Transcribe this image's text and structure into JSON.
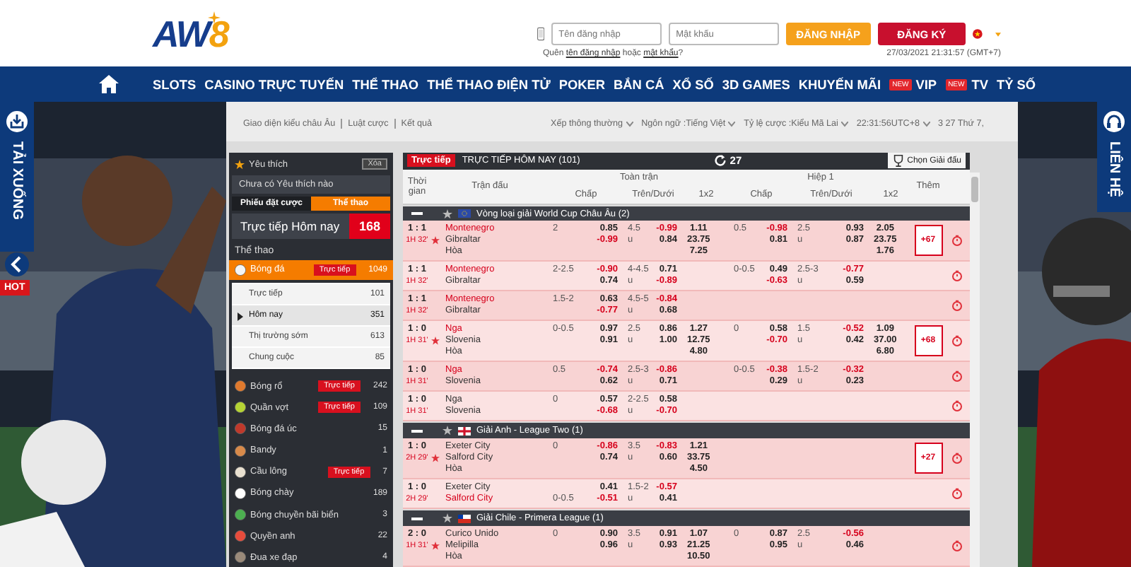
{
  "header": {
    "logo": {
      "main": "AW",
      "accent": "8"
    },
    "username": {
      "placeholder": "Tên đăng nhập"
    },
    "password": {
      "placeholder": "Mật khẩu"
    },
    "login": "ĐĂNG NHẬP",
    "register": "ĐĂNG KÝ",
    "forgot": {
      "before": "Quên",
      "link1": "tên đăng nhập",
      "middle": "hoặc",
      "link2": "mật khẩu",
      "after": "?"
    },
    "clock": "27/03/2021 21:31:57 (GMT+7)"
  },
  "nav": [
    {
      "label": "SLOTS"
    },
    {
      "label": "CASINO TRỰC TUYẾN"
    },
    {
      "label": "THỂ THAO"
    },
    {
      "label": "THỂ THAO ĐIỆN TỬ"
    },
    {
      "label": "POKER"
    },
    {
      "label": "BẮN CÁ"
    },
    {
      "label": "XỔ SỐ"
    },
    {
      "label": "3D GAMES"
    },
    {
      "label": "KHUYẾN MÃI"
    },
    {
      "label": "VIP",
      "badge": "NEW"
    },
    {
      "label": "TV",
      "badge": "NEW"
    },
    {
      "label": "TỶ SỐ"
    }
  ],
  "side_tabs": {
    "left": "TẢI XUỐNG",
    "hot": "HOT",
    "right": "LIÊN HỆ"
  },
  "top_links": [
    "Giao diện kiểu châu Âu",
    "Luật cược",
    "Kết quả"
  ],
  "settings": [
    {
      "label": "Xếp thông thường",
      "kind": "dropdown"
    },
    {
      "label": "Ngôn ngữ :Tiếng Việt",
      "kind": "dropdown"
    },
    {
      "label": "Tỷ lệ cược :Kiểu Mã Lai",
      "kind": "dropdown"
    },
    {
      "label": "22:31:56UTC+8",
      "kind": "dropdown"
    },
    {
      "label": "3 27 Thứ 7,",
      "kind": "text"
    }
  ],
  "sidebar": {
    "favorites": {
      "title": "Yêu thích",
      "clear": "Xóa",
      "empty": "Chưa có Yêu thích nào"
    },
    "tabs": [
      {
        "label": "Phiếu đặt cược",
        "selected": false
      },
      {
        "label": "Thể thao",
        "selected": true
      }
    ],
    "live_today": {
      "label": "Trực tiếp Hôm nay",
      "count": "168"
    },
    "section": "Thể thao",
    "sports": [
      {
        "name": "Bóng đá",
        "live": "Trực tiếp",
        "count": "1049",
        "selected": true,
        "children": [
          {
            "name": "Trực tiếp",
            "count": "101",
            "selected": false
          },
          {
            "name": "Hôm nay",
            "count": "351",
            "selected": true
          },
          {
            "name": "Thị trường sớm",
            "count": "613",
            "selected": false
          },
          {
            "name": "Chung cuộc",
            "count": "85",
            "selected": false
          }
        ]
      },
      {
        "name": "Bóng rổ",
        "live": "Trực tiếp",
        "count": "242",
        "selected": false
      },
      {
        "name": "Quần vợt",
        "live": "Trực tiếp",
        "count": "109",
        "selected": false
      },
      {
        "name": "Bóng đá úc",
        "count": "15",
        "selected": false
      },
      {
        "name": "Bandy",
        "count": "1",
        "selected": false
      },
      {
        "name": "Cầu lông",
        "live": "Trực tiếp",
        "count": "7",
        "selected": false
      },
      {
        "name": "Bóng chày",
        "count": "189",
        "selected": false
      },
      {
        "name": "Bóng chuyền bãi biển",
        "count": "3",
        "selected": false
      },
      {
        "name": "Quyền anh",
        "count": "22",
        "selected": false
      },
      {
        "name": "Đua xe đạp",
        "count": "4",
        "selected": false
      }
    ]
  },
  "table": {
    "badge": "Trực tiếp",
    "title": "TRỰC TIẾP HÔM NAY (101)",
    "refresh": "27",
    "choose": "Chọn Giải đấu",
    "columns": {
      "time": "Thời gian",
      "match": "Trận đấu",
      "full": "Toàn trận",
      "full_sub": [
        "Chấp",
        "Trên/Dưới",
        "1x2"
      ],
      "half": "Hiệp 1",
      "half_sub": [
        "Chấp",
        "Trên/Dưới",
        "1x2"
      ],
      "more": "Thêm"
    },
    "groups": [
      {
        "name": "Vòng loại giải World Cup Châu Âu (2)",
        "kind": "eu",
        "rows": [
          {
            "score": "1 : 1",
            "period": "1H 32'",
            "favorite": true,
            "teams": [
              {
                "name": "Montenegro",
                "favored": true
              },
              {
                "name": "Gibraltar",
                "favored": false
              }
            ],
            "draw": "Hòa",
            "ft": {
              "hcp": {
                "line": "2",
                "odds": [
                  "0.85",
                  "-0.99"
                ]
              },
              "ou": {
                "line": "4.5",
                "under": "u",
                "odds": [
                  "-0.99",
                  "0.84"
                ]
              },
              "x12": [
                "1.11",
                "23.75",
                "7.25"
              ]
            },
            "h1": {
              "hcp": {
                "line": "0.5",
                "odds": [
                  "-0.98",
                  "0.81"
                ]
              },
              "ou": {
                "line": "2.5",
                "under": "u",
                "odds": [
                  "0.93",
                  "0.87"
                ]
              },
              "x12": [
                "2.05",
                "23.75",
                "1.76"
              ]
            },
            "more": "+67"
          },
          {
            "score": "1 : 1",
            "period": "1H 32'",
            "favorite": false,
            "teams": [
              {
                "name": "Montenegro",
                "favored": true
              },
              {
                "name": "Gibraltar",
                "favored": false
              }
            ],
            "ft": {
              "hcp": {
                "line": "2-2.5",
                "odds": [
                  "-0.90",
                  "0.74"
                ]
              },
              "ou": {
                "line": "4-4.5",
                "under": "u",
                "odds": [
                  "0.71",
                  "-0.89"
                ]
              }
            },
            "h1": {
              "hcp": {
                "line": "0-0.5",
                "odds": [
                  "0.49",
                  "-0.63"
                ]
              },
              "ou": {
                "line": "2.5-3",
                "under": "u",
                "odds": [
                  "-0.77",
                  "0.59"
                ]
              }
            }
          },
          {
            "score": "1 : 1",
            "period": "1H 32'",
            "favorite": false,
            "teams": [
              {
                "name": "Montenegro",
                "favored": true
              },
              {
                "name": "Gibraltar",
                "favored": false
              }
            ],
            "ft": {
              "hcp": {
                "line": "1.5-2",
                "odds": [
                  "0.63",
                  "-0.77"
                ]
              },
              "ou": {
                "line": "4.5-5",
                "under": "u",
                "odds": [
                  "-0.84",
                  "0.68"
                ]
              }
            }
          },
          {
            "score": "1 : 0",
            "period": "1H 31'",
            "favorite": true,
            "teams": [
              {
                "name": "Nga",
                "favored": true
              },
              {
                "name": "Slovenia",
                "favored": false
              }
            ],
            "draw": "Hòa",
            "ft": {
              "hcp": {
                "line": "0-0.5",
                "odds": [
                  "0.97",
                  "0.91"
                ]
              },
              "ou": {
                "line": "2.5",
                "under": "u",
                "odds": [
                  "0.86",
                  "1.00"
                ]
              },
              "x12": [
                "1.27",
                "12.75",
                "4.80"
              ]
            },
            "h1": {
              "hcp": {
                "line": "0",
                "odds": [
                  "0.58",
                  "-0.70"
                ]
              },
              "ou": {
                "line": "1.5",
                "under": "u",
                "odds": [
                  "-0.52",
                  "0.42"
                ]
              },
              "x12": [
                "1.09",
                "37.00",
                "6.80"
              ]
            },
            "more": "+68"
          },
          {
            "score": "1 : 0",
            "period": "1H 31'",
            "favorite": false,
            "teams": [
              {
                "name": "Nga",
                "favored": true
              },
              {
                "name": "Slovenia",
                "favored": false
              }
            ],
            "ft": {
              "hcp": {
                "line": "0.5",
                "odds": [
                  "-0.74",
                  "0.62"
                ]
              },
              "ou": {
                "line": "2.5-3",
                "under": "u",
                "odds": [
                  "-0.86",
                  "0.71"
                ]
              }
            },
            "h1": {
              "hcp": {
                "line": "0-0.5",
                "odds": [
                  "-0.38",
                  "0.29"
                ]
              },
              "ou": {
                "line": "1.5-2",
                "under": "u",
                "odds": [
                  "-0.32",
                  "0.23"
                ]
              }
            }
          },
          {
            "score": "1 : 0",
            "period": "1H 31'",
            "favorite": false,
            "teams": [
              {
                "name": "Nga",
                "favored": false
              },
              {
                "name": "Slovenia",
                "favored": false
              }
            ],
            "ft": {
              "hcp": {
                "line": "0",
                "odds": [
                  "0.57",
                  "-0.68"
                ]
              },
              "ou": {
                "line": "2-2.5",
                "under": "u",
                "odds": [
                  "0.58",
                  "-0.70"
                ]
              }
            }
          }
        ]
      },
      {
        "name": "Giải Anh - League Two (1)",
        "kind": "england",
        "rows": [
          {
            "score": "1 : 0",
            "period": "2H 29'",
            "favorite": true,
            "teams": [
              {
                "name": "Exeter City",
                "favored": false
              },
              {
                "name": "Salford City",
                "favored": false
              }
            ],
            "draw": "Hòa",
            "ft": {
              "hcp": {
                "line": "0",
                "odds": [
                  "-0.86",
                  "0.74"
                ]
              },
              "ou": {
                "line": "3.5",
                "under": "u",
                "odds": [
                  "-0.83",
                  "0.60"
                ]
              },
              "x12": [
                "1.21",
                "33.75",
                "4.50"
              ]
            },
            "more": "+27"
          },
          {
            "score": "1 : 0",
            "period": "2H 29'",
            "favorite": false,
            "teams": [
              {
                "name": "Exeter City",
                "favored": false
              },
              {
                "name": "Salford City",
                "favored": true
              }
            ],
            "ft": {
              "hcp": {
                "line": "0-0.5",
                "odds": [
                  "0.41",
                  "-0.51"
                ]
              },
              "ou": {
                "line": "1.5-2",
                "under": "u",
                "odds": [
                  "-0.57",
                  "0.41"
                ]
              }
            }
          }
        ]
      },
      {
        "name": "Giải Chile - Primera League (1)",
        "kind": "chile",
        "rows": [
          {
            "score": "2 : 0",
            "period": "1H 31'",
            "favorite": true,
            "teams": [
              {
                "name": "Curico Unido",
                "favored": false
              },
              {
                "name": "Melipilla",
                "favored": false
              }
            ],
            "draw": "Hòa",
            "ft": {
              "hcp": {
                "line": "0",
                "odds": [
                  "0.90",
                  "0.96"
                ]
              },
              "ou": {
                "line": "3.5",
                "under": "u",
                "odds": [
                  "0.91",
                  "0.93"
                ]
              },
              "x12": [
                "1.07",
                "21.25",
                "10.50"
              ]
            },
            "h1": {
              "hcp": {
                "line": "0",
                "odds": [
                  "0.87",
                  "0.95"
                ]
              },
              "ou": {
                "line": "2.5",
                "under": "u",
                "odds": [
                  "-0.56",
                  "0.46"
                ]
              }
            }
          }
        ]
      }
    ]
  }
}
